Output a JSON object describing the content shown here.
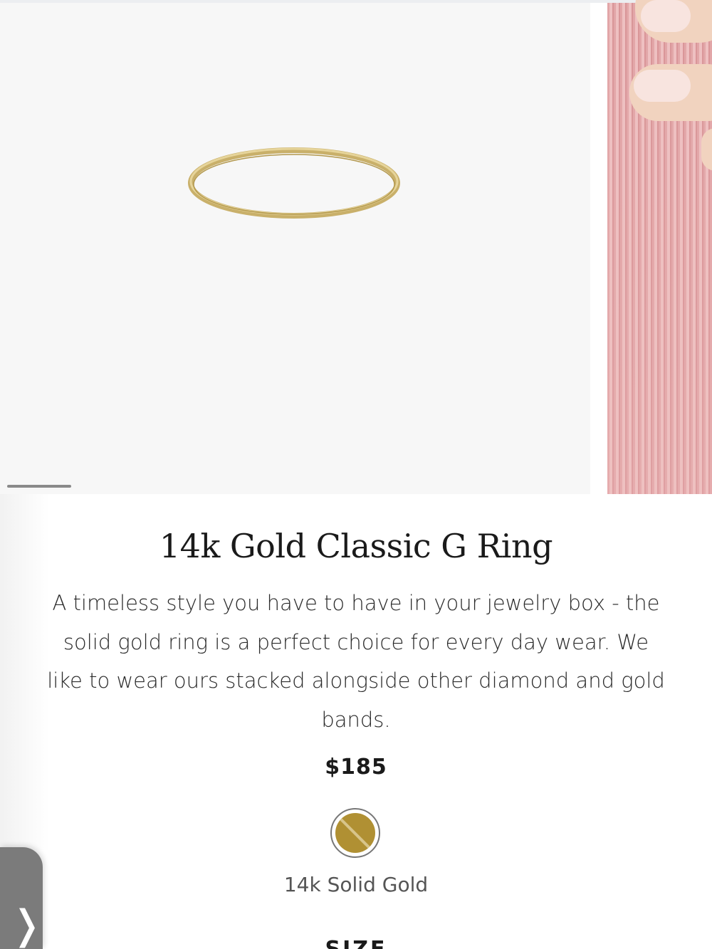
{
  "product": {
    "title": "14k Gold Classic G Ring",
    "description": "A timeless style you have to have in your jewelry box - the solid gold ring is a perfect choice for every day wear. We like to wear ours stacked alongside other diamond and gold bands.",
    "price": "$185",
    "material": {
      "label": "14k Solid Gold",
      "color": "#b09033"
    },
    "size_label": "SIZE"
  },
  "gallery": {
    "images": [
      "ring-product-photo",
      "model-wearing-ring-photo"
    ],
    "active_index": 0,
    "indicator_color": "#8a8a8a"
  },
  "nav": {
    "side_tab_icon": "chevron-right-icon",
    "side_tab_glyph": "❭"
  }
}
